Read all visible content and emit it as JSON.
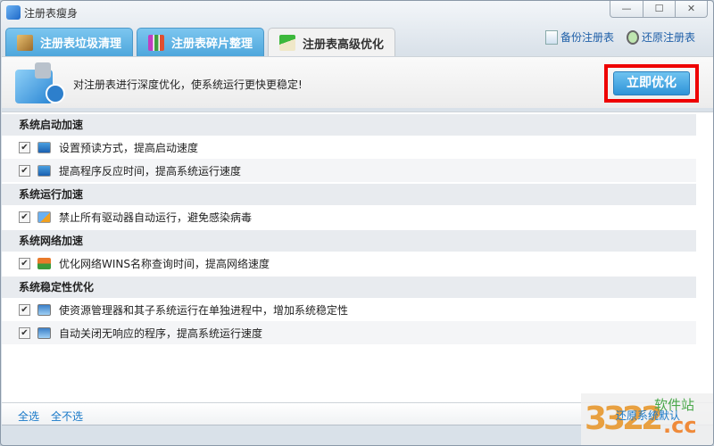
{
  "window": {
    "title": "注册表瘦身",
    "minimize": "—",
    "maximize": "☐",
    "close": "✕"
  },
  "tabs": [
    {
      "label": "注册表垃圾清理",
      "icon": "broom-icon",
      "active": false
    },
    {
      "label": "注册表碎片整理",
      "icon": "bar-chart-icon",
      "active": false
    },
    {
      "label": "注册表高级优化",
      "icon": "trend-up-icon",
      "active": true
    }
  ],
  "toplinks": {
    "backup": "备份注册表",
    "restore": "还原注册表"
  },
  "header": {
    "text": "对注册表进行深度优化，使系统运行更快更稳定!",
    "optimize_button": "立即优化"
  },
  "sections": [
    {
      "title": "系统启动加速",
      "items": [
        {
          "label": "设置预读方式，提高启动速度",
          "checked": true,
          "icon": "list-window-icon"
        },
        {
          "label": "提高程序反应时间，提高系统运行速度",
          "checked": true,
          "icon": "list-window-icon"
        }
      ]
    },
    {
      "title": "系统运行加速",
      "items": [
        {
          "label": "禁止所有驱动器自动运行，避免感染病毒",
          "checked": true,
          "icon": "drive-lightning-icon"
        }
      ]
    },
    {
      "title": "系统网络加速",
      "items": [
        {
          "label": "优化网络WINS名称查询时间，提高网络速度",
          "checked": true,
          "icon": "network-icon"
        }
      ]
    },
    {
      "title": "系统稳定性优化",
      "items": [
        {
          "label": "使资源管理器和其子系统运行在单独进程中，增加系统稳定性",
          "checked": true,
          "icon": "monitor-pulse-icon"
        },
        {
          "label": "自动关闭无响应的程序，提高系统运行速度",
          "checked": true,
          "icon": "monitor-pulse-icon"
        }
      ]
    }
  ],
  "footer": {
    "select_all": "全选",
    "select_none": "全不选",
    "restore_default": "还原系统默认"
  },
  "watermark": {
    "text": "3322.cc 软件站"
  },
  "colors": {
    "accent": "#2e93d8",
    "tab_blue": "#4ea7dc",
    "link": "#1778c8",
    "highlight_box": "#ee0000"
  }
}
